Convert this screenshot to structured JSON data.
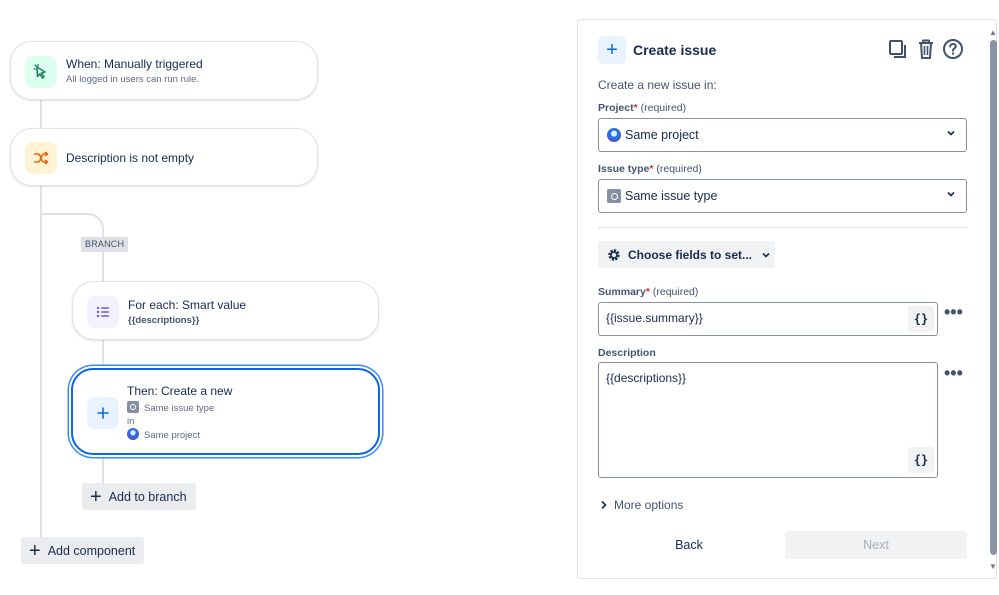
{
  "canvas": {
    "trigger": {
      "title": "When: Manually triggered",
      "subtitle": "All logged in users can run rule.",
      "icon": "cursor-click-icon"
    },
    "condition": {
      "title": "Description is not empty",
      "icon": "shuffle-icon"
    },
    "branch_label": "BRANCH",
    "foreach": {
      "title": "For each: Smart value",
      "subtitle": "{{descriptions}}",
      "icon": "list-icon"
    },
    "action": {
      "title": "Then: Create a new",
      "line1": "Same issue type",
      "line2": "in",
      "line3": "Same project",
      "icon": "plus-icon"
    },
    "add_to_branch": "Add to branch",
    "add_component": "Add component"
  },
  "panel": {
    "title": "Create issue",
    "intro": "Create a new issue in:",
    "project": {
      "label": "Project",
      "required_text": "(required)",
      "value": "Same project"
    },
    "issue_type": {
      "label": "Issue type",
      "required_text": "(required)",
      "value": "Same issue type"
    },
    "choose_fields": "Choose fields to set...",
    "summary": {
      "label": "Summary",
      "required_text": "(required)",
      "value": "{{issue.summary}}"
    },
    "description": {
      "label": "Description",
      "value": "{{descriptions}}"
    },
    "brace_button": "{}",
    "more_options": "More options",
    "back": "Back",
    "next": "Next"
  },
  "colors": {
    "accent_blue": "#0c66e4",
    "trigger_bg": "#dcfff1",
    "condition_bg": "#fff3d6",
    "branch_bg": "#f3f0ff",
    "action_bg": "#e9f2ff"
  }
}
